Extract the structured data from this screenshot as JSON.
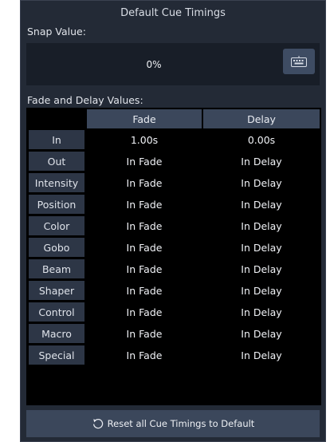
{
  "panel": {
    "title": "Default Cue Timings"
  },
  "snap": {
    "label": "Snap Value:",
    "value": "0%",
    "keyboard_icon": "keyboard-icon"
  },
  "fade_delay": {
    "label": "Fade and Delay Values:",
    "columns": [
      "Fade",
      "Delay"
    ],
    "rows": [
      {
        "label": "In",
        "fade": "1.00s",
        "delay": "0.00s"
      },
      {
        "label": "Out",
        "fade": "In Fade",
        "delay": "In Delay"
      },
      {
        "label": "Intensity",
        "fade": "In Fade",
        "delay": "In Delay"
      },
      {
        "label": "Position",
        "fade": "In Fade",
        "delay": "In Delay"
      },
      {
        "label": "Color",
        "fade": "In Fade",
        "delay": "In Delay"
      },
      {
        "label": "Gobo",
        "fade": "In Fade",
        "delay": "In Delay"
      },
      {
        "label": "Beam",
        "fade": "In Fade",
        "delay": "In Delay"
      },
      {
        "label": "Shaper",
        "fade": "In Fade",
        "delay": "In Delay"
      },
      {
        "label": "Control",
        "fade": "In Fade",
        "delay": "In Delay"
      },
      {
        "label": "Macro",
        "fade": "In Fade",
        "delay": "In Delay"
      },
      {
        "label": "Special",
        "fade": "In Fade",
        "delay": "In Delay"
      }
    ]
  },
  "reset": {
    "label": "Reset all Cue Timings to Default",
    "icon": "reset-arrow-icon"
  },
  "colors": {
    "panel_bg": "#232a36",
    "header_bg": "#3b475b",
    "row_label_bg": "#2d3646",
    "grid_bg": "#000000"
  }
}
